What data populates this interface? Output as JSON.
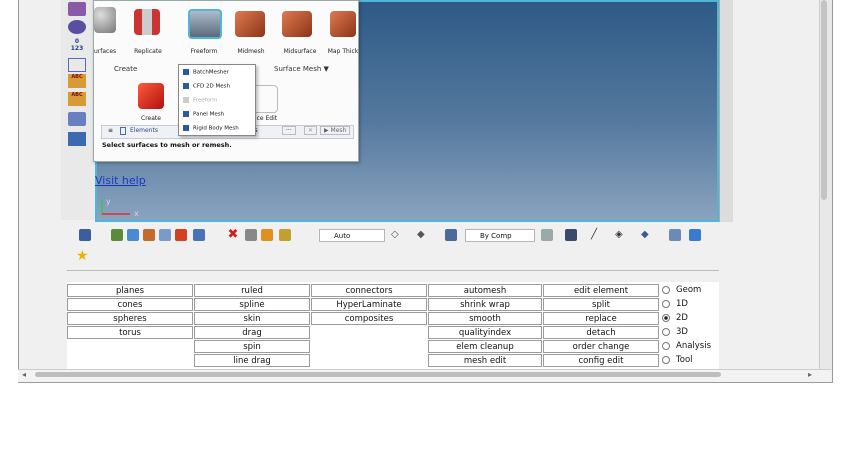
{
  "popup": {
    "top_labels": [
      "urfaces",
      "Replicate",
      "Freeform",
      "Midmesh",
      "Midsurface",
      "Map Thick"
    ],
    "sections": {
      "create": "Create",
      "surface_mesh": "Surface Mesh ▼"
    },
    "bottom_labels": {
      "create": "Create",
      "face_edit": "ace Edit"
    },
    "dropdown_items": [
      {
        "label": "BatchMesher",
        "enabled": true
      },
      {
        "label": "CFD 2D Mesh",
        "enabled": true
      },
      {
        "label": "Freeform",
        "enabled": false
      },
      {
        "label": "Panel Mesh",
        "enabled": true
      },
      {
        "label": "Rigid Body Mesh",
        "enabled": true
      }
    ],
    "toolbar": {
      "entity": "Elements",
      "rs": "rs",
      "dots": "···",
      "mesh": "▶ Mesh"
    },
    "hint": "Select surfaces to mesh or remesh."
  },
  "visit_help": "Visit help",
  "axis": {
    "y": "y",
    "x": "x"
  },
  "toolbar": {
    "auto": "Auto",
    "by_comp": "By Comp"
  },
  "panel": {
    "columns": [
      [
        "planes",
        "cones",
        "spheres",
        "torus"
      ],
      [
        "ruled",
        "spline",
        "skin",
        "drag",
        "spin",
        "line drag"
      ],
      [
        "connectors",
        "HyperLaminate",
        "composites"
      ],
      [
        "automesh",
        "shrink wrap",
        "smooth",
        "qualityindex",
        "elem cleanup",
        "mesh edit"
      ],
      [
        "edit element",
        "split",
        "replace",
        "detach",
        "order change",
        "config edit"
      ]
    ],
    "radios": [
      {
        "label": "Geom",
        "selected": false
      },
      {
        "label": "1D",
        "selected": false
      },
      {
        "label": "2D",
        "selected": true
      },
      {
        "label": "3D",
        "selected": false
      },
      {
        "label": "Analysis",
        "selected": false
      },
      {
        "label": "Tool",
        "selected": false
      }
    ]
  },
  "colors": {
    "accent": "#4fb6d6",
    "viewport_top": "#2e5a86",
    "link": "#1a36c8"
  }
}
